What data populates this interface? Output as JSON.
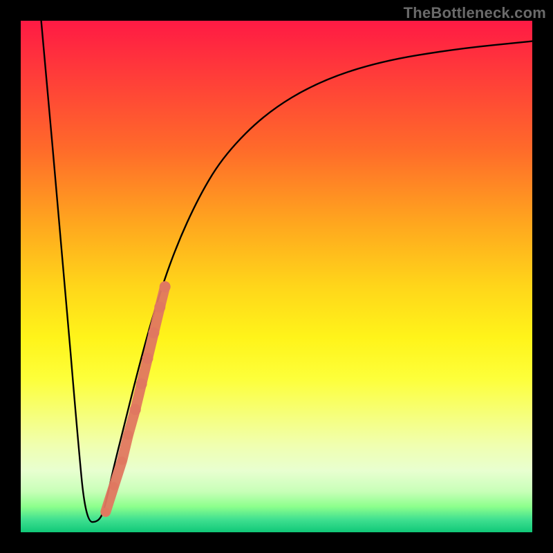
{
  "watermark": "TheBottleneck.com",
  "chart_data": {
    "type": "line",
    "title": "",
    "xlabel": "",
    "ylabel": "",
    "xlim": [
      0,
      100
    ],
    "ylim": [
      0,
      100
    ],
    "background_gradient": {
      "top": "#ff1a44",
      "bottom": "#10c878",
      "stops": [
        "red",
        "orange",
        "yellow",
        "pale-yellow",
        "green"
      ]
    },
    "series": [
      {
        "name": "curve",
        "color": "#000000",
        "points": [
          {
            "x": 4.0,
            "y": 100.0
          },
          {
            "x": 8.5,
            "y": 50.0
          },
          {
            "x": 11.0,
            "y": 20.0
          },
          {
            "x": 12.7,
            "y": 2.0
          },
          {
            "x": 15.3,
            "y": 2.0
          },
          {
            "x": 16.5,
            "y": 5.0
          },
          {
            "x": 18.0,
            "y": 12.0
          },
          {
            "x": 20.0,
            "y": 20.0
          },
          {
            "x": 23.0,
            "y": 32.0
          },
          {
            "x": 26.0,
            "y": 43.0
          },
          {
            "x": 30.0,
            "y": 55.0
          },
          {
            "x": 35.0,
            "y": 66.0
          },
          {
            "x": 40.0,
            "y": 74.0
          },
          {
            "x": 48.0,
            "y": 82.0
          },
          {
            "x": 58.0,
            "y": 88.0
          },
          {
            "x": 70.0,
            "y": 92.0
          },
          {
            "x": 85.0,
            "y": 94.5
          },
          {
            "x": 100.0,
            "y": 96.0
          }
        ]
      },
      {
        "name": "marker-band",
        "color": "#e07860",
        "type": "scatter",
        "points": [
          {
            "x": 16.6,
            "y": 4.0,
            "r": 6
          },
          {
            "x": 18.2,
            "y": 9.0,
            "r": 6
          },
          {
            "x": 19.8,
            "y": 14.0,
            "r": 6
          },
          {
            "x": 21.0,
            "y": 19.0,
            "r": 7
          },
          {
            "x": 22.4,
            "y": 24.0,
            "r": 8
          },
          {
            "x": 23.6,
            "y": 29.0,
            "r": 8
          },
          {
            "x": 24.8,
            "y": 34.0,
            "r": 8
          },
          {
            "x": 26.0,
            "y": 39.0,
            "r": 8
          },
          {
            "x": 27.2,
            "y": 44.0,
            "r": 8
          },
          {
            "x": 28.2,
            "y": 48.0,
            "r": 8
          }
        ]
      }
    ]
  }
}
